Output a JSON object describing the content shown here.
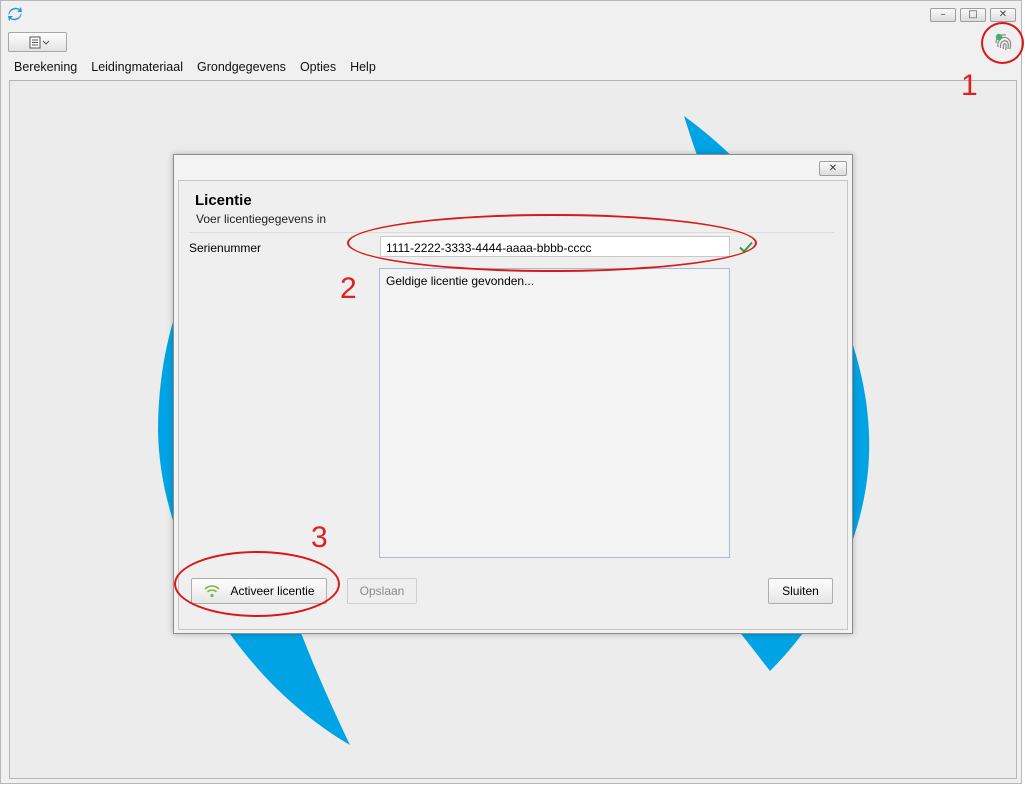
{
  "window": {
    "controls": {
      "minimize": "–",
      "maximize": "□",
      "close": "✕"
    },
    "toolbar_icon": "document-view-icon",
    "status_icon": "fingerprint-icon"
  },
  "menu": {
    "items": [
      {
        "label": "Berekening"
      },
      {
        "label": "Leidingmateriaal"
      },
      {
        "label": "Grondgegevens"
      },
      {
        "label": "Opties"
      },
      {
        "label": "Help"
      }
    ]
  },
  "annotations": {
    "one": "1",
    "two": "2",
    "three": "3"
  },
  "dialog": {
    "title": "Licentie",
    "subtitle": "Voer licentiegegevens in",
    "close": "✕",
    "serial_label": "Serienummer",
    "serial_value": "1111-2222-3333-4444-aaaa-bbbb-cccc",
    "log_text": "Geldige licentie gevonden...",
    "activate_label": "Activeer licentie",
    "save_label": "Opslaan",
    "close_label": "Sluiten"
  },
  "colors": {
    "accent_blue": "#00a4e4",
    "annotation_red": "#e02020",
    "check_green": "#2ea043",
    "wifi_green": "#7cb342"
  }
}
